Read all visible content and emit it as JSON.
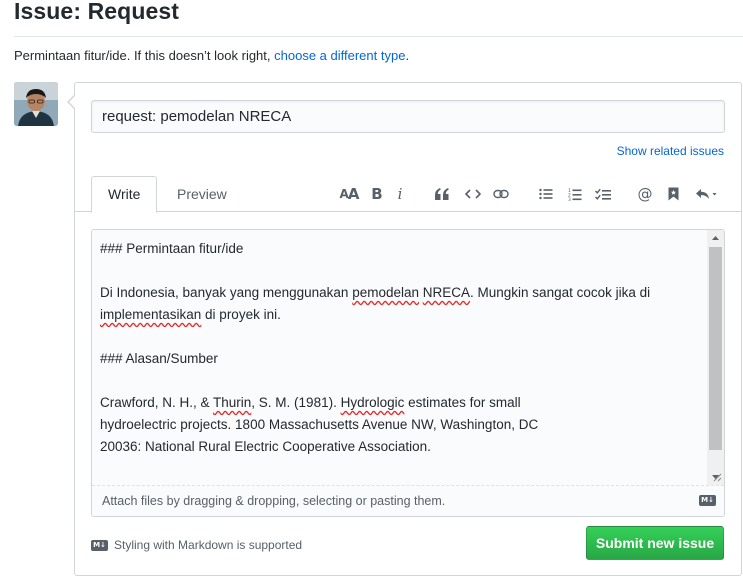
{
  "header": {
    "title": "Issue: Request",
    "template_note": "Permintaan fitur/ide. If this doesn’t look right,",
    "template_link": "choose a different type",
    "template_end": "."
  },
  "form": {
    "title_value": "request: pemodelan NRECA",
    "related_link": "Show related issues",
    "tabs": [
      {
        "label": "Write",
        "selected": true
      },
      {
        "label": "Preview",
        "selected": false
      }
    ],
    "toolbar": [
      {
        "name": "header-text-icon",
        "glyph": "AA"
      },
      {
        "name": "bold-icon",
        "glyph": "B"
      },
      {
        "name": "italic-icon",
        "glyph": "i"
      },
      {
        "name": "quote-icon",
        "glyph": "quote"
      },
      {
        "name": "code-icon",
        "glyph": "code"
      },
      {
        "name": "link-icon",
        "glyph": "link"
      },
      {
        "name": "bulleted-list-icon",
        "glyph": "list"
      },
      {
        "name": "numbered-list-icon",
        "glyph": "olist"
      },
      {
        "name": "task-list-icon",
        "glyph": "task"
      },
      {
        "name": "mention-icon",
        "glyph": "@"
      },
      {
        "name": "saved-reply-icon",
        "glyph": "bookmark"
      },
      {
        "name": "reply-icon",
        "glyph": "reply"
      }
    ],
    "body": {
      "line1": "### Permintaan fitur/ide",
      "line2a": "Di Indonesia, banyak yang menggunakan ",
      "line2b": "pemodelan",
      "line2c": " ",
      "line2d": "NRECA",
      "line2e": ". Mungkin sangat cocok jika di",
      "line3a": "implementasikan",
      "line3b": " di proyek ini.",
      "line4": "### Alasan/Sumber",
      "line5a": "Crawford, N. H., & ",
      "line5b": "Thurin",
      "line5c": ", S. M. (1981). ",
      "line5d": "Hydrologic",
      "line5e": " estimates for small",
      "line6": "hydroelectric projects. 1800 Massachusetts Avenue NW, Washington, DC",
      "line7": "20036: National Rural Electric Cooperative Association."
    },
    "attach_text": "Attach files by dragging & dropping, selecting or pasting them.",
    "markdown_note": "Styling with Markdown is supported",
    "md_badge": "M↓",
    "submit_label": "Submit new issue"
  },
  "colors": {
    "link": "#0366d6",
    "submit": "#28a745",
    "border": "#d1d5da",
    "spellcheck": "#e03131"
  }
}
